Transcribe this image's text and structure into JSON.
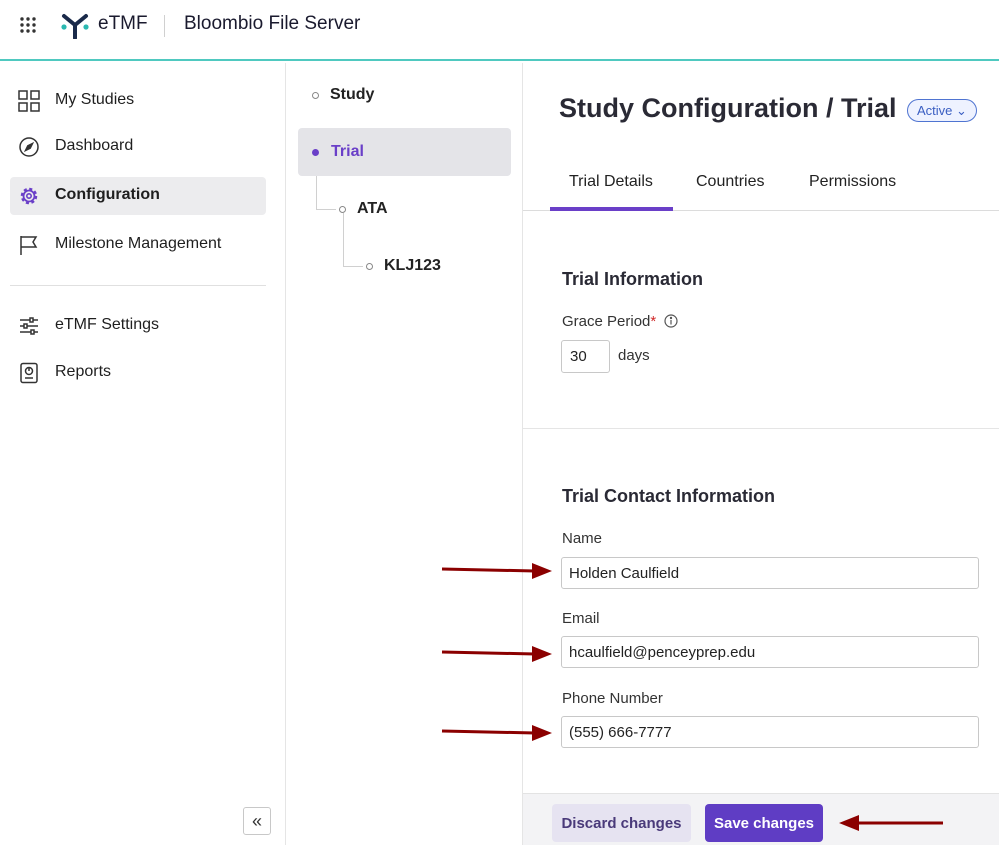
{
  "topbar": {
    "brand": "eTMF",
    "server_name": "Bloombio File Server"
  },
  "nav": {
    "items": [
      {
        "label": "My Studies",
        "icon": "grid-squares-icon"
      },
      {
        "label": "Dashboard",
        "icon": "compass-icon"
      },
      {
        "label": "Configuration",
        "icon": "gear-icon",
        "active": true
      },
      {
        "label": "Milestone Management",
        "icon": "flag-icon"
      },
      {
        "label": "eTMF Settings",
        "icon": "sliders-icon"
      },
      {
        "label": "Reports",
        "icon": "report-icon"
      }
    ],
    "collapse_label": "«"
  },
  "tree": {
    "items": [
      {
        "label": "Study"
      },
      {
        "label": "Trial",
        "active": true
      },
      {
        "label": "ATA"
      },
      {
        "label": "KLJ123"
      }
    ]
  },
  "main": {
    "title": "Study Configuration / Trial",
    "status": "Active ⌄",
    "tabs": [
      "Trial Details",
      "Countries",
      "Permissions"
    ],
    "trial_info": {
      "title": "Trial Information",
      "grace_label": "Grace Period",
      "required_mark": "*",
      "grace_value": "30",
      "grace_unit": "days"
    },
    "contact": {
      "title": "Trial Contact Information",
      "name_label": "Name",
      "name_value": "Holden Caulfield",
      "email_label": "Email",
      "email_value": "hcaulfield@penceyprep.edu",
      "phone_label": "Phone Number",
      "phone_value": "(555) 666-7777"
    },
    "footer": {
      "discard_label": "Discard changes",
      "save_label": "Save changes"
    }
  },
  "colors": {
    "accent": "#5f3dc4",
    "topbar_border": "#4fc9c0",
    "annotation_arrow": "#8b0000"
  }
}
